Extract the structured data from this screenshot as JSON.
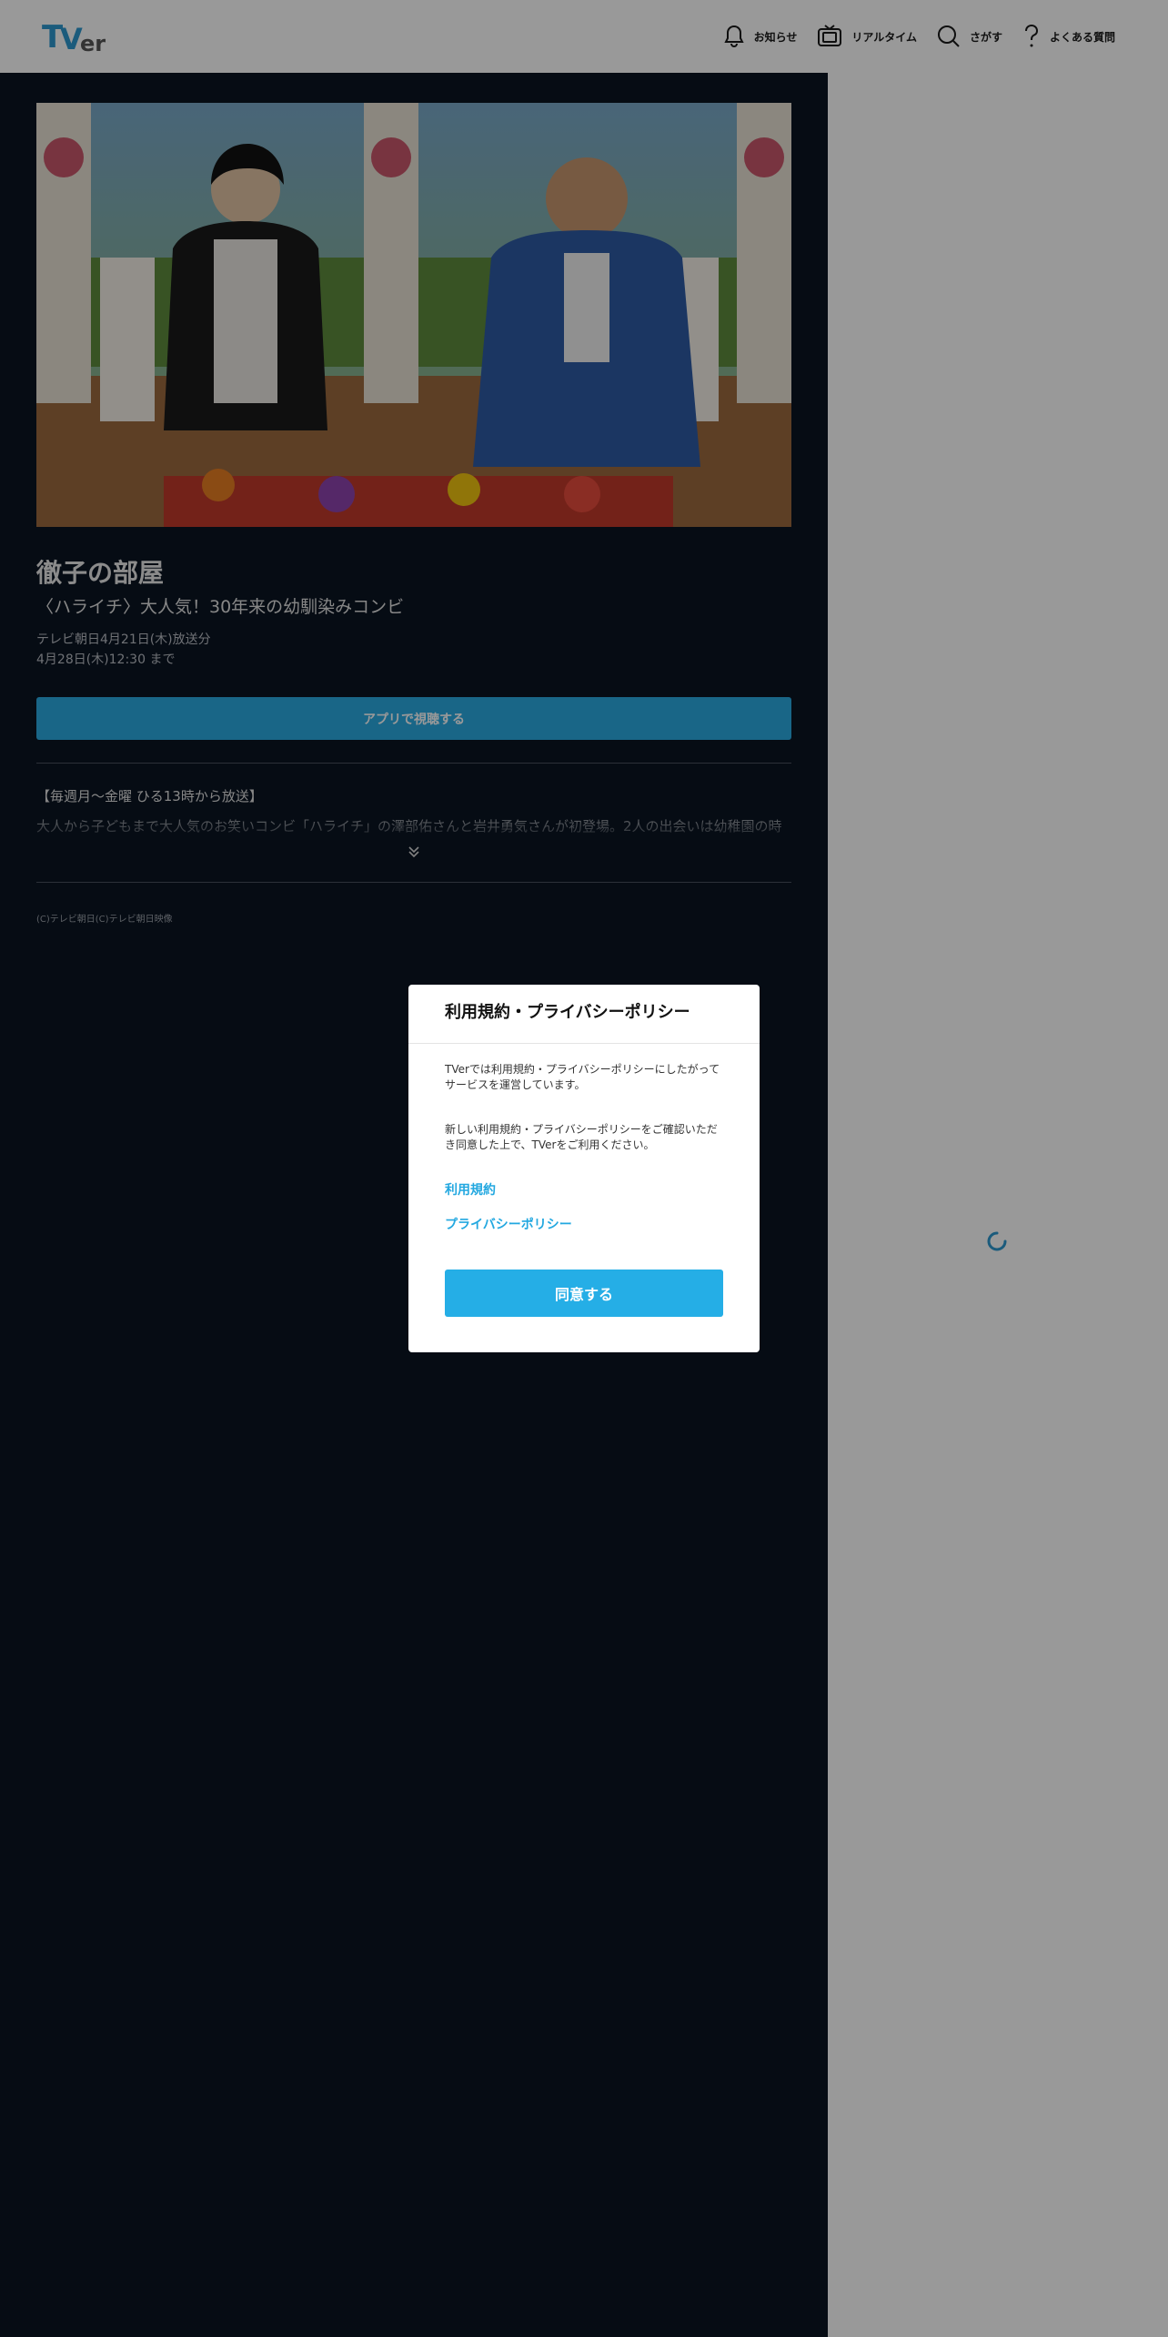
{
  "header": {
    "logo_text": "TVer",
    "nav": [
      {
        "label": "お知らせ",
        "icon": "bell-icon"
      },
      {
        "label": "リアルタイム",
        "icon": "tv-icon"
      },
      {
        "label": "さがす",
        "icon": "search-icon"
      },
      {
        "label": "よくある質問",
        "icon": "question-icon"
      }
    ]
  },
  "episode": {
    "thumbnail_caption": "(C)テレビ朝日",
    "title": "徹子の部屋",
    "subtitle": "〈ハライチ〉大人気！30年来の幼馴染みコンビ",
    "broadcast": "テレビ朝日4月21日(木)放送分",
    "available_until": "4月28日(木)12:30 まで",
    "app_button": "アプリで視聴する",
    "description_title": "【毎週月～金曜 ひる13時から放送】",
    "description_text": "大人から子どもまで大人気のお笑いコンビ「ハライチ」の澤部佑さんと岩井勇気さんが初登場。2人の出会いは幼稚園の時",
    "copyright": "(C)テレビ朝日(C)テレビ朝日映像"
  },
  "modal": {
    "title": "利用規約・プライバシーポリシー",
    "paragraph1": "TVerでは利用規約・プライバシーポリシーにしたがってサービスを運営しています。",
    "paragraph2": "新しい利用規約・プライバシーポリシーをご確認いただき同意した上で、TVerをご利用ください。",
    "link_terms": "利用規約",
    "link_privacy": "プライバシーポリシー",
    "agree_button": "同意する"
  },
  "colors": {
    "brand_blue": "#25aee6",
    "dark_bg": "#0a1422"
  }
}
